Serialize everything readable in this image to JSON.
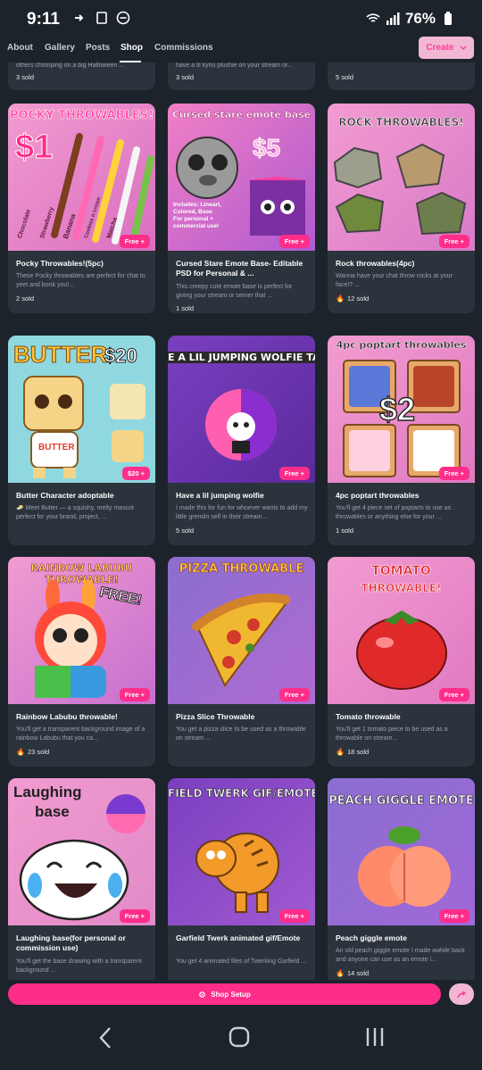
{
  "status": {
    "time": "9:11",
    "battery": "76%"
  },
  "nav": {
    "tabs": [
      "About",
      "Gallery",
      "Posts",
      "Shop",
      "Commissions"
    ],
    "create_label": "Create"
  },
  "top_row": [
    {
      "desc": "others chomping on a big Halloween ...",
      "sold": "3 sold"
    },
    {
      "desc": "have a lil kyrio plushie on your stream or...",
      "sold": "3 sold"
    },
    {
      "desc": "",
      "sold": "5 sold"
    }
  ],
  "products": [
    {
      "title": "Pocky Throwables!(5pc)",
      "desc": "These Pocky throwables are perfect for chat to yeet and bonk you!...",
      "sold": "2 sold",
      "badge": "Free +",
      "hot": false,
      "art_title": "POCKY THROWABLES!",
      "art_price": "$1",
      "art_words": [
        "Chocolate",
        "Strawberry",
        "Banana",
        "Cookies n cream",
        "Matcha"
      ]
    },
    {
      "title": "Cursed Stare Emote Base- Editable PSD for Personal & ...",
      "desc": "This creepy cute emote base is perfect for giving your stream or server that ...",
      "sold": "1 sold",
      "badge": "Free +",
      "hot": false,
      "art_title": "Cursed stare emote base",
      "art_price": "$5",
      "art_words": [
        "Includes: Lineart,",
        "Colored, Base",
        "For personal +",
        "commercial use!"
      ]
    },
    {
      "title": "Rock throwables(4pc)",
      "desc": "Wanna have your chat throw rocks at your face!? ...",
      "sold": "12 sold",
      "badge": "Free +",
      "hot": true,
      "art_title": "ROCK THROWABLES!",
      "art_price": "",
      "art_words": []
    },
    {
      "title": "Butter Character adoptable",
      "desc": "🧈 Meet Butter — a squishy, melty mascot perfect for your brand, project, ...",
      "sold": "",
      "badge": "$20 +",
      "hot": false,
      "art_title": "BUTTER",
      "art_price": "$20",
      "art_words": [
        "BUTTER"
      ]
    },
    {
      "title": "Have a lil jumping wolfie",
      "desc": "I made this for fun for whoever wants to add my little gremlin self in their stream...",
      "sold": "5 sold",
      "badge": "Free +",
      "hot": false,
      "art_title": "E A LIL JUMPING WOLFIE TAU",
      "art_price": "",
      "art_words": []
    },
    {
      "title": "4pc poptart throwables",
      "desc": "You'll get 4 piece set of poptarts to use as throwables or anything else for your ...",
      "sold": "1 sold",
      "badge": "Free +",
      "hot": false,
      "art_title": "4pc poptart throwables",
      "art_price": "$2",
      "art_words": []
    },
    {
      "title": "Rainbow Labubu throwable!",
      "desc": "You'll get a transparent background image of a rainbow Labubu that you ca...",
      "sold": "23 sold",
      "badge": "Free +",
      "hot": true,
      "art_title": "RAINBOW LABUBU THROWABLE!",
      "art_price": "FREE!",
      "art_words": []
    },
    {
      "title": "Pizza Slice Throwable",
      "desc": "You get a pizza slice to be used as a throwable on stream ...",
      "sold": "",
      "badge": "Free +",
      "hot": false,
      "art_title": "PIZZA THROWABLE",
      "art_price": "",
      "art_words": []
    },
    {
      "title": "Tomato throwable",
      "desc": "You'll get 1 tomato piece to be used as a throwable on stream...",
      "sold": "18 sold",
      "badge": "Free +",
      "hot": true,
      "art_title": "TOMATO",
      "art_price": "THROWABLE!",
      "art_words": []
    },
    {
      "title": "Laughing base(for personal or commission use)",
      "desc": "You'll get the base drawing with a transparent background ...",
      "sold": "",
      "badge": "Free +",
      "hot": false,
      "art_title": "Laughing",
      "art_price": "base",
      "art_words": []
    },
    {
      "title": "Garfield Twerk animated gif/Emote",
      "desc": "You get 4 animated files of Twerking Garfield ...",
      "sold": "",
      "badge": "Free +",
      "hot": false,
      "art_title": "FIELD TWERK GIF/EMOTE",
      "art_price": "",
      "art_words": []
    },
    {
      "title": "Peach giggle emote",
      "desc": "An old peach giggle emote I made awhile back and anyone can use as an emote i...",
      "sold": "14 sold",
      "badge": "Free +",
      "hot": true,
      "art_title": "PEACH GIGGLE EMOTE",
      "art_price": "",
      "art_words": []
    }
  ],
  "footer": {
    "shop_setup_label": "Shop Setup"
  },
  "colors": {
    "accent": "#ff2d8a",
    "card": "#2b333c",
    "bg": "#1c232b"
  }
}
